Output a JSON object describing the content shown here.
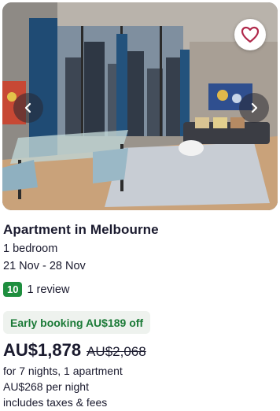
{
  "listing": {
    "title": "Apartment in Melbourne",
    "bedrooms": "1 bedroom",
    "dates": "21 Nov - 28 Nov",
    "rating_score": "10",
    "review_count": "1 review",
    "deal_label": "Early booking AU$189 off",
    "price": "AU$1,878",
    "original_price": "AU$2,068",
    "stay_summary": "for 7 nights, 1 apartment",
    "price_per_night": "AU$268 per night",
    "taxes_note": "includes taxes & fees"
  },
  "icons": {
    "favorite": "heart-icon",
    "previous": "chevron-left-icon",
    "next": "chevron-right-icon"
  },
  "colors": {
    "rating_badge": "#1e8e3e",
    "deal_text": "#1b7a37",
    "deal_background": "#eef2ee",
    "favorite_heart": "#b0284a"
  }
}
